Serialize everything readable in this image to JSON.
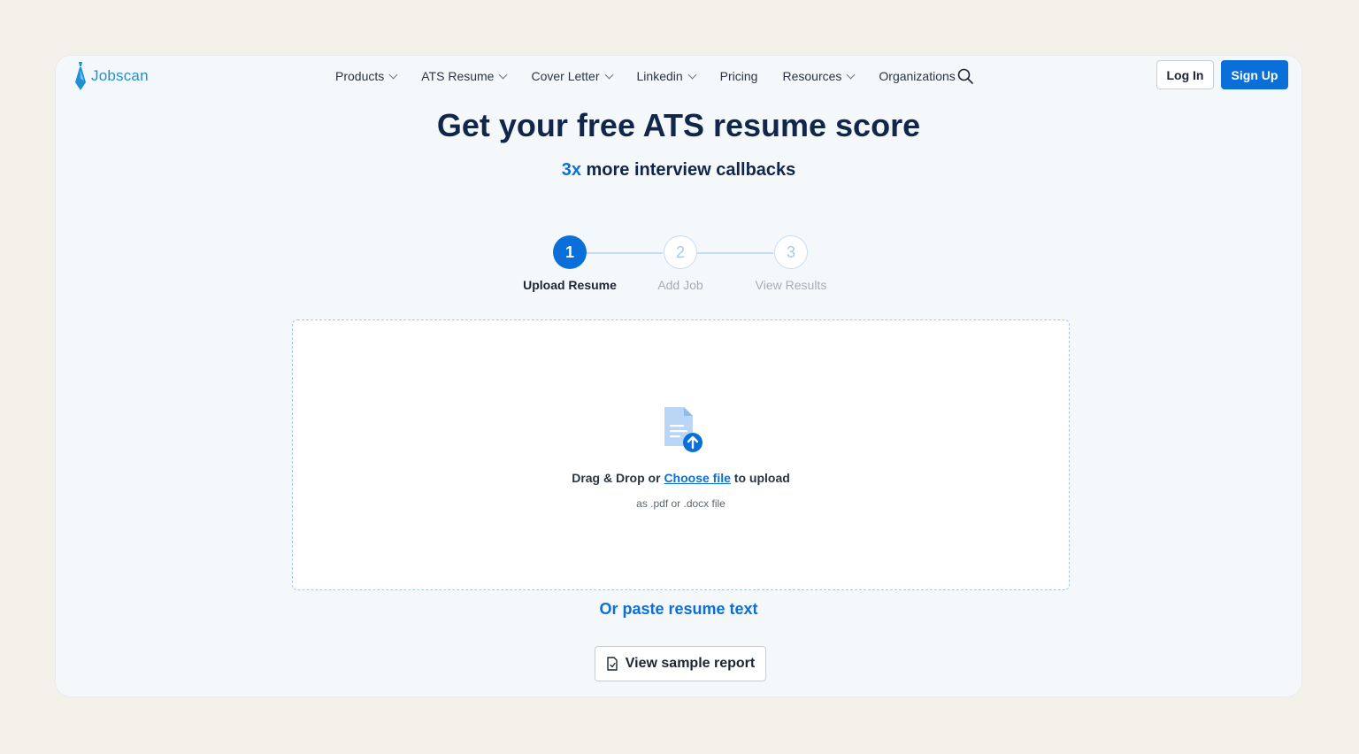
{
  "header": {
    "logo_text": "Jobscan",
    "nav": [
      {
        "label": "Products",
        "dropdown": true
      },
      {
        "label": "ATS Resume",
        "dropdown": true
      },
      {
        "label": "Cover Letter",
        "dropdown": true
      },
      {
        "label": "Linkedin",
        "dropdown": true
      },
      {
        "label": "Pricing",
        "dropdown": false
      },
      {
        "label": "Resources",
        "dropdown": true
      },
      {
        "label": "Organizations",
        "dropdown": false
      }
    ],
    "login_label": "Log In",
    "signup_label": "Sign Up"
  },
  "hero": {
    "title": "Get your free ATS resume score",
    "subtitle_accent": "3x",
    "subtitle_rest": " more interview callbacks"
  },
  "steps": [
    {
      "number": "1",
      "label": "Upload Resume",
      "state": "active"
    },
    {
      "number": "2",
      "label": "Add Job",
      "state": "inactive"
    },
    {
      "number": "3",
      "label": "View Results",
      "state": "inactive"
    }
  ],
  "upload": {
    "drag_text": "Drag & Drop or ",
    "choose_file": "Choose file",
    "to_upload": " to upload",
    "hint": "as .pdf or .docx file"
  },
  "paste_link": "Or paste resume text",
  "sample_button": "View sample report",
  "colors": {
    "accent": "#0b6fd9",
    "page_bg": "#f4f1ea",
    "card_bg": "#f5f8fb",
    "title": "#10264a"
  },
  "icons": {
    "logo": "tie-logo-icon",
    "search": "search-icon",
    "upload": "document-upload-icon",
    "sample": "document-icon"
  }
}
